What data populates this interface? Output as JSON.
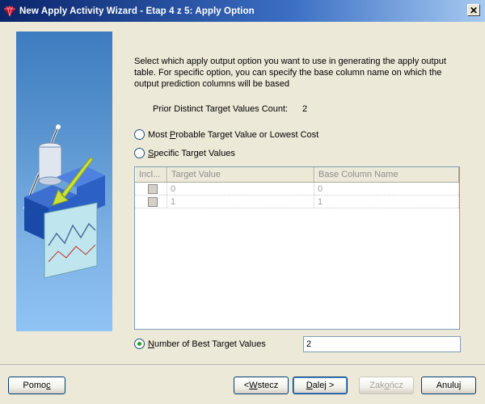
{
  "window": {
    "title": "New Apply Activity Wizard - Etap 4 z 5: Apply Option",
    "close_glyph": "✕"
  },
  "content": {
    "intro": "Select which apply output option you want to use in generating the apply output table.  For specific option, you can specify the base column name on which the output prediction columns will be based",
    "count_label": "Prior Distinct Target Values Count:",
    "count_value": "2"
  },
  "options": {
    "most_probable": {
      "pre": "Most ",
      "accel": "P",
      "post": "robable Target Value or Lowest Cost",
      "checked": false
    },
    "specific": {
      "pre": "",
      "accel": "S",
      "post": "pecific Target Values",
      "checked": false
    },
    "best_n": {
      "pre": "",
      "accel": "N",
      "post": "umber of Best Target Values",
      "checked": true
    }
  },
  "table": {
    "columns": [
      "Incl...",
      "Target Value",
      "Base Column Name"
    ],
    "rows": [
      {
        "target": "0",
        "base": "0"
      },
      {
        "target": "1",
        "base": "1"
      }
    ]
  },
  "best_n_value": "2",
  "buttons": {
    "help": {
      "pre": "Pomo",
      "accel": "c",
      "post": ""
    },
    "back": {
      "pre": "< ",
      "accel": "W",
      "post": "stecz"
    },
    "next": {
      "pre": "",
      "accel": "D",
      "post": "alej >"
    },
    "finish": {
      "pre": "Zak",
      "accel": "o",
      "post": "ńcz"
    },
    "cancel": {
      "pre": "Anuluj",
      "accel": "",
      "post": ""
    }
  },
  "colors": {
    "title_gradient_start": "#0a246a",
    "title_gradient_end": "#a6caf0",
    "dialog_bg": "#ece9d8",
    "radio_checked": "#21a121"
  },
  "icons": {
    "app": "oracle-red-gem-icon",
    "side": "data-mining-wizard-illustration"
  }
}
